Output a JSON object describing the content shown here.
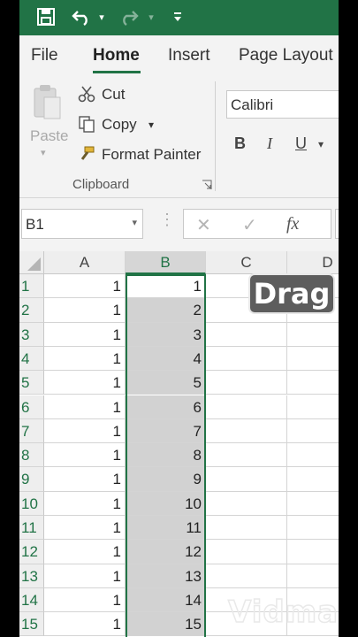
{
  "quick_access": {
    "save_icon": "floppy-disk-icon",
    "undo_icon": "undo-icon",
    "redo_icon": "redo-icon",
    "customize_icon": "customize-qat-icon"
  },
  "tabs": [
    "File",
    "Home",
    "Insert",
    "Page Layout"
  ],
  "active_tab": "Home",
  "clipboard": {
    "paste_label": "Paste",
    "cut_label": "Cut",
    "copy_label": "Copy",
    "format_painter_label": "Format Painter",
    "group_label": "Clipboard"
  },
  "font": {
    "name": "Calibri",
    "bold_label": "B",
    "italic_label": "I",
    "underline_label": "U"
  },
  "formula_bar": {
    "name_box": "B1",
    "cancel_symbol": "✕",
    "enter_symbol": "✓",
    "fx_label": "fx"
  },
  "grid": {
    "columns": [
      "A",
      "B",
      "C",
      "D"
    ],
    "selected_column": "B",
    "row_numbers": [
      "1",
      "2",
      "3",
      "4",
      "5",
      "6",
      "7",
      "8",
      "9",
      "10",
      "11",
      "12",
      "13",
      "14",
      "15"
    ],
    "col_a": [
      "1",
      "1",
      "1",
      "1",
      "1",
      "1",
      "1",
      "1",
      "1",
      "1",
      "1",
      "1",
      "1",
      "1",
      "1"
    ],
    "col_b": [
      "1",
      "2",
      "3",
      "4",
      "5",
      "6",
      "7",
      "8",
      "9",
      "10",
      "11",
      "12",
      "13",
      "14",
      "15"
    ]
  },
  "overlay": {
    "drag_label": "Drag",
    "watermark": "Vidma"
  },
  "colors": {
    "excel_green": "#217346",
    "selection_fill": "#d2d2d2"
  }
}
